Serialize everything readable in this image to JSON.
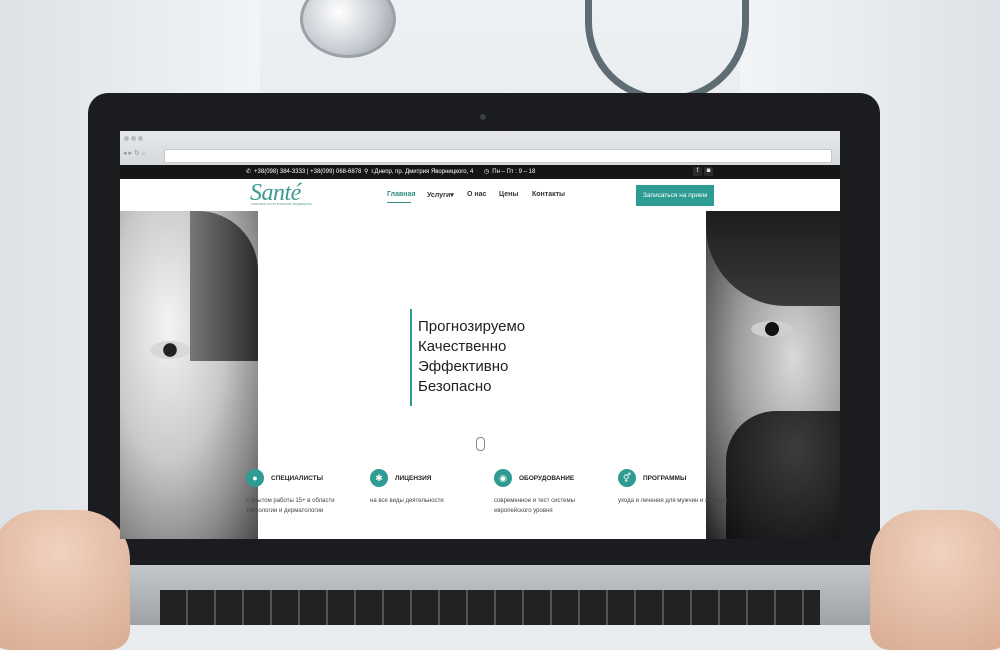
{
  "topbar": {
    "phones": "+38(098) 384-3333 | +38(099) 068-6878",
    "address": "г.Днепр, пр. Дмитрия Яворницкого, 4",
    "hours": "Пн – Пт : 9 – 18",
    "social": [
      "f",
      "◙"
    ]
  },
  "logo": {
    "name": "Santé",
    "subtitle": "клиника эстетической медицины"
  },
  "nav": {
    "items": [
      {
        "label": "Главная"
      },
      {
        "label": "Услуги"
      },
      {
        "label": "О нас"
      },
      {
        "label": "Цены"
      },
      {
        "label": "Контакты"
      }
    ],
    "cta": "Записаться на прием"
  },
  "hero": {
    "lines": [
      "Прогнозируемо",
      "Качественно",
      "Эффективно",
      "Безопасно"
    ]
  },
  "features": [
    {
      "title": "СПЕЦИАЛИСТЫ",
      "desc": "с опытом работы 15+ в области трихологии и дерматологии",
      "icon": "person-icon"
    },
    {
      "title": "ЛИЦЕНЗИЯ",
      "desc": "на все виды деятельности",
      "icon": "badge-icon"
    },
    {
      "title": "ОБОРУДОВАНИЕ",
      "desc": "современное и тест системы европейского уровня",
      "icon": "globe-icon"
    },
    {
      "title": "ПРОГРАММЫ",
      "desc": "ухода и лечения для мужчин и женщин",
      "icon": "gender-icon"
    }
  ],
  "colors": {
    "accent": "#2e9c93",
    "topbar": "#151515"
  }
}
